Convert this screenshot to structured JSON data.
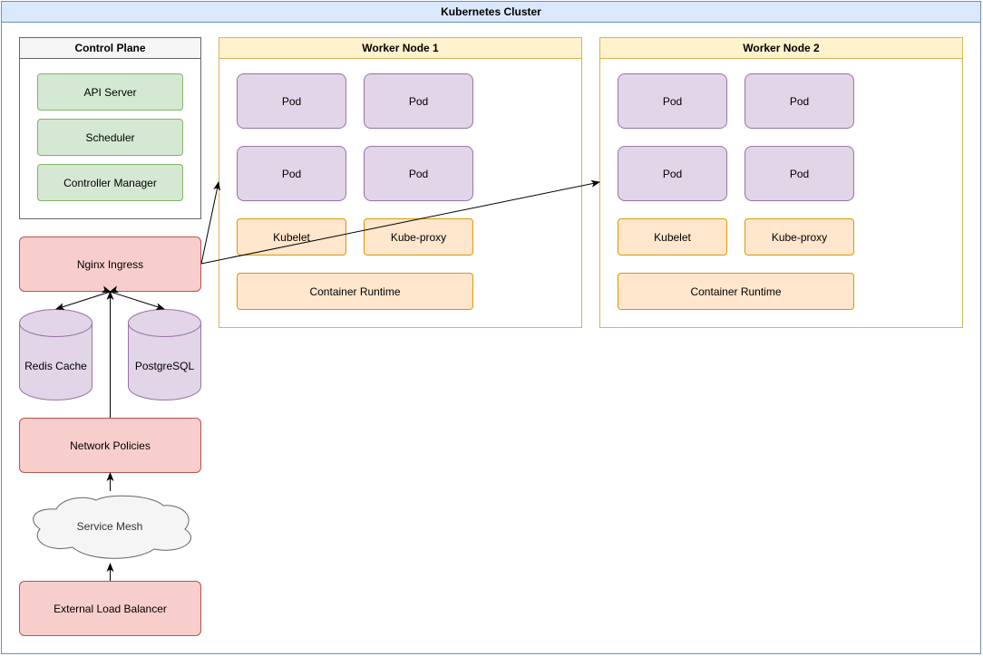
{
  "cluster": {
    "title": "Kubernetes Cluster"
  },
  "control_plane": {
    "title": "Control Plane",
    "components": [
      "API Server",
      "Scheduler",
      "Controller Manager"
    ]
  },
  "worker_nodes": [
    {
      "title": "Worker Node 1",
      "pods": [
        "Pod",
        "Pod",
        "Pod",
        "Pod"
      ],
      "kubelet": "Kubelet",
      "kube_proxy": "Kube-proxy",
      "runtime": "Container Runtime"
    },
    {
      "title": "Worker Node 2",
      "pods": [
        "Pod",
        "Pod",
        "Pod",
        "Pod"
      ],
      "kubelet": "Kubelet",
      "kube_proxy": "Kube-proxy",
      "runtime": "Container Runtime"
    }
  ],
  "ingress": {
    "label": "Nginx Ingress"
  },
  "datastores": {
    "redis": "Redis Cache",
    "postgres": "PostgreSQL"
  },
  "network_policies": {
    "label": "Network Policies"
  },
  "service_mesh": {
    "label": "Service Mesh"
  },
  "load_balancer": {
    "label": "External Load Balancer"
  },
  "colors": {
    "cluster_header": "#dae8fc",
    "control_components": "#d5e8d4",
    "pods": "#e1d5e7",
    "node_components": "#ffe6cc",
    "network_elements": "#f8cecc",
    "worker_header": "#fff2cc"
  }
}
